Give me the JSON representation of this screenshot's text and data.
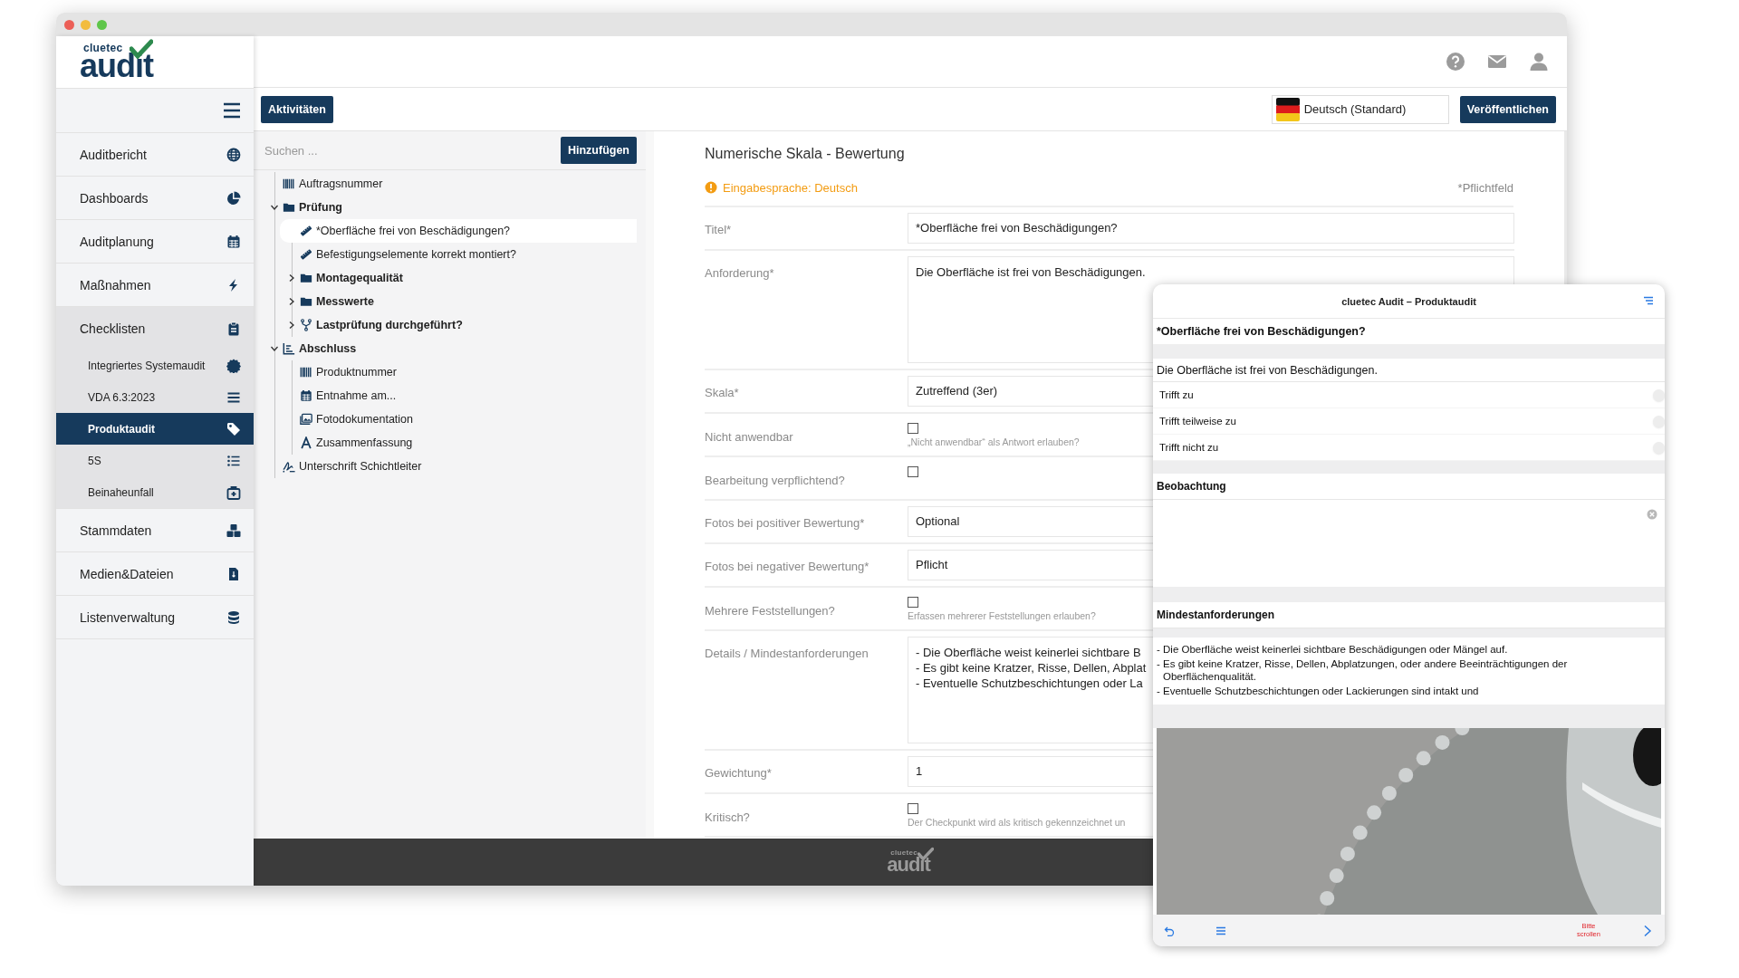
{
  "logo": {
    "brand": "cluetec",
    "product": "audit"
  },
  "sidebar": {
    "items": [
      {
        "label": "Auditbericht",
        "selected": false
      },
      {
        "label": "Dashboards",
        "selected": false
      },
      {
        "label": "Auditplanung",
        "selected": false
      },
      {
        "label": "Maßnahmen",
        "selected": false
      },
      {
        "label": "Checklisten",
        "selected": false,
        "expanded": true,
        "children": [
          {
            "label": "Integriertes Systemaudit",
            "selected": false
          },
          {
            "label": "VDA 6.3:2023",
            "selected": false
          },
          {
            "label": "Produktaudit",
            "selected": true
          },
          {
            "label": "5S",
            "selected": false
          },
          {
            "label": "Beinaheunfall",
            "selected": false
          }
        ]
      },
      {
        "label": "Stammdaten",
        "selected": false
      },
      {
        "label": "Medien&Dateien",
        "selected": false
      },
      {
        "label": "Listenverwaltung",
        "selected": false
      }
    ]
  },
  "toolbar": {
    "activities_button": "Aktivitäten",
    "language": "Deutsch (Standard)",
    "publish_button": "Veröffentlichen"
  },
  "tree": {
    "search": {
      "placeholder": "Suchen ..."
    },
    "add_button": "Hinzufügen",
    "items": [
      {
        "label": "Auftragsnummer",
        "kind": "barcode",
        "selected": false
      },
      {
        "label": "Prüfung",
        "kind": "folder",
        "selected": false,
        "expanded": true,
        "children": [
          {
            "label": "*Oberfläche frei von Beschädigungen?",
            "kind": "ruler",
            "selected": true
          },
          {
            "label": "Befestigungselemente korrekt montiert?",
            "kind": "ruler",
            "selected": false
          },
          {
            "label": "Montagequalität",
            "kind": "folder",
            "selected": false,
            "expanded": false
          },
          {
            "label": "Messwerte",
            "kind": "folder",
            "selected": false,
            "expanded": false
          },
          {
            "label": "Lastprüfung durchgeführt?",
            "kind": "fork",
            "selected": false,
            "expanded": false
          }
        ]
      },
      {
        "label": "Abschluss",
        "kind": "chart",
        "selected": false,
        "expanded": true,
        "children": [
          {
            "label": "Produktnummer",
            "kind": "barcode",
            "selected": false
          },
          {
            "label": "Entnahme am...",
            "kind": "calendar",
            "selected": false
          },
          {
            "label": "Fotodokumentation",
            "kind": "photos",
            "selected": false
          },
          {
            "label": "Zusammenfassung",
            "kind": "font",
            "selected": false
          }
        ]
      },
      {
        "label": "Unterschrift Schichtleiter",
        "kind": "signature",
        "selected": false
      }
    ]
  },
  "form": {
    "title": "Numerische Skala - Bewertung",
    "language_notice": "Eingabesprache: Deutsch",
    "required_note": "*Pflichtfeld",
    "fields": [
      {
        "label": "Titel*",
        "kind": "text",
        "value": "*Oberfläche frei von Beschädigungen?"
      },
      {
        "label": "Anforderung*",
        "kind": "textarea",
        "lines": [
          "Die Oberfläche ist frei von Beschädigungen."
        ]
      },
      {
        "label": "Skala*",
        "kind": "text",
        "value": "Zutreffend (3er)"
      },
      {
        "label": "Nicht anwendbar",
        "kind": "checkbox",
        "checked": false,
        "hint": "„Nicht anwendbar“ als Antwort erlauben?"
      },
      {
        "label": "Bearbeitung verpflichtend?",
        "kind": "checkbox",
        "checked": false
      },
      {
        "label": "Fotos bei positiver Bewertung*",
        "kind": "text",
        "value": "Optional"
      },
      {
        "label": "Fotos bei negativer Bewertung*",
        "kind": "text",
        "value": "Pflicht"
      },
      {
        "label": "Mehrere Feststellungen?",
        "kind": "checkbox",
        "checked": false,
        "hint": "Erfassen mehrerer Feststellungen erlauben?"
      },
      {
        "label": "Details / Mindestanforderungen",
        "kind": "textarea",
        "lines": [
          "- Die Oberfläche weist keinerlei sichtbare B",
          "- Es gibt keine Kratzer, Risse, Dellen, Abplat",
          "- Eventuelle Schutzbeschichtungen oder La"
        ]
      },
      {
        "label": "Gewichtung*",
        "kind": "text",
        "value": "1"
      },
      {
        "label": "Kritisch?",
        "kind": "checkbox",
        "checked": false,
        "hint": "Der Checkpunkt wird als kritisch gekennzeichnet un"
      }
    ]
  },
  "footer_logo": {
    "brand": "cluetec",
    "product": "audit"
  },
  "preview": {
    "title": "cluetec Audit – Produktaudit",
    "question": "*Oberfläche frei von Beschädigungen?",
    "requirement": "Die Oberfläche ist frei von Beschädigungen.",
    "options": [
      {
        "label": "Trifft zu",
        "selected": false
      },
      {
        "label": "Trifft teilweise zu",
        "selected": false
      },
      {
        "label": "Trifft nicht zu",
        "selected": false
      }
    ],
    "observation_heading": "Beobachtung",
    "minimum_heading": "Mindestanforderungen",
    "minimum_lines": [
      "- Die Oberfläche weist keinerlei sichtbare Beschädigungen oder Mängel auf.",
      "- Es gibt keine Kratzer, Risse, Dellen, Abplatzungen, oder andere Beeinträchtigungen der Oberflächenqualität.",
      "- Eventuelle Schutzbeschichtungen oder Lackierungen sind intakt und"
    ],
    "picture": {
      "kind": "picture"
    },
    "scroll_hint": "Bitte scrollen"
  }
}
